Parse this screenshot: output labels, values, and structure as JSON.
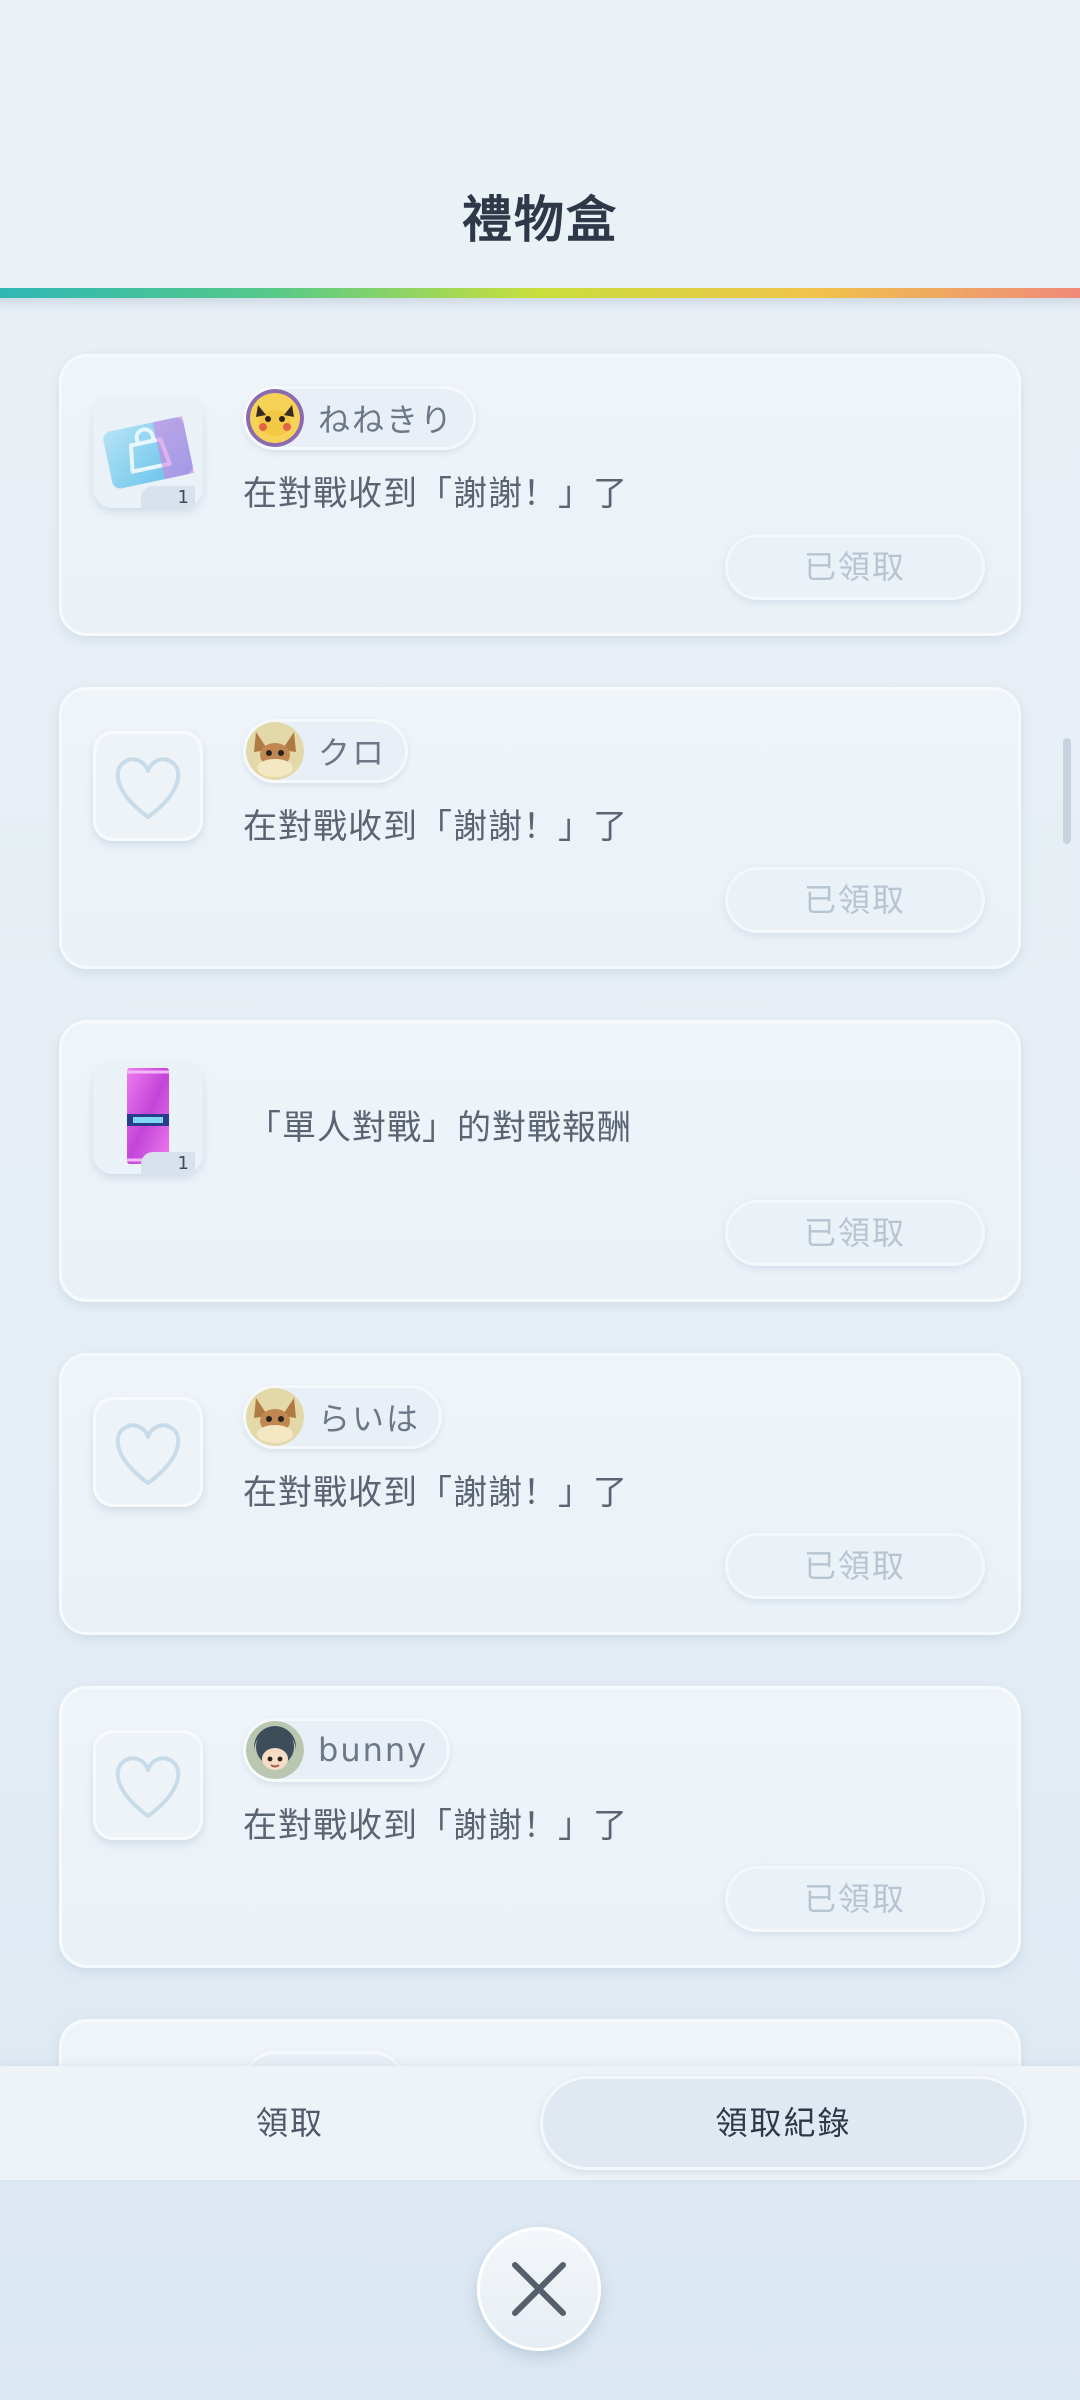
{
  "title": "禮物盒",
  "colors": {
    "background": "#e7eff6",
    "rainbow": [
      "#2fb7b4",
      "#55c98a",
      "#c9df3c",
      "#f0c44a",
      "#ef8a7a"
    ],
    "claimed_text": "#b7c4d2"
  },
  "items": [
    {
      "type": "item-shopping-bag",
      "count": "1",
      "sender": "ねねきり",
      "avatar": "pikachu-avatar",
      "message": "在對戰收到「謝謝！」了",
      "status": "已領取"
    },
    {
      "type": "heart",
      "count": "",
      "sender": "クロ",
      "avatar": "eevee-avatar",
      "message": "在對戰收到「謝謝！」了",
      "status": "已領取"
    },
    {
      "type": "item-booster-pack",
      "count": "1",
      "sender": "",
      "avatar": "",
      "message": "「單人對戰」的對戰報酬",
      "status": "已領取"
    },
    {
      "type": "heart",
      "count": "",
      "sender": "らいは",
      "avatar": "eevee-avatar",
      "message": "在對戰收到「謝謝！」了",
      "status": "已領取"
    },
    {
      "type": "heart",
      "count": "",
      "sender": "bunny",
      "avatar": "trainer-avatar",
      "message": "在對戰收到「謝謝！」了",
      "status": "已領取"
    }
  ],
  "tabs": {
    "claim": "領取",
    "history": "領取紀錄"
  },
  "close_icon": "close-x-icon"
}
